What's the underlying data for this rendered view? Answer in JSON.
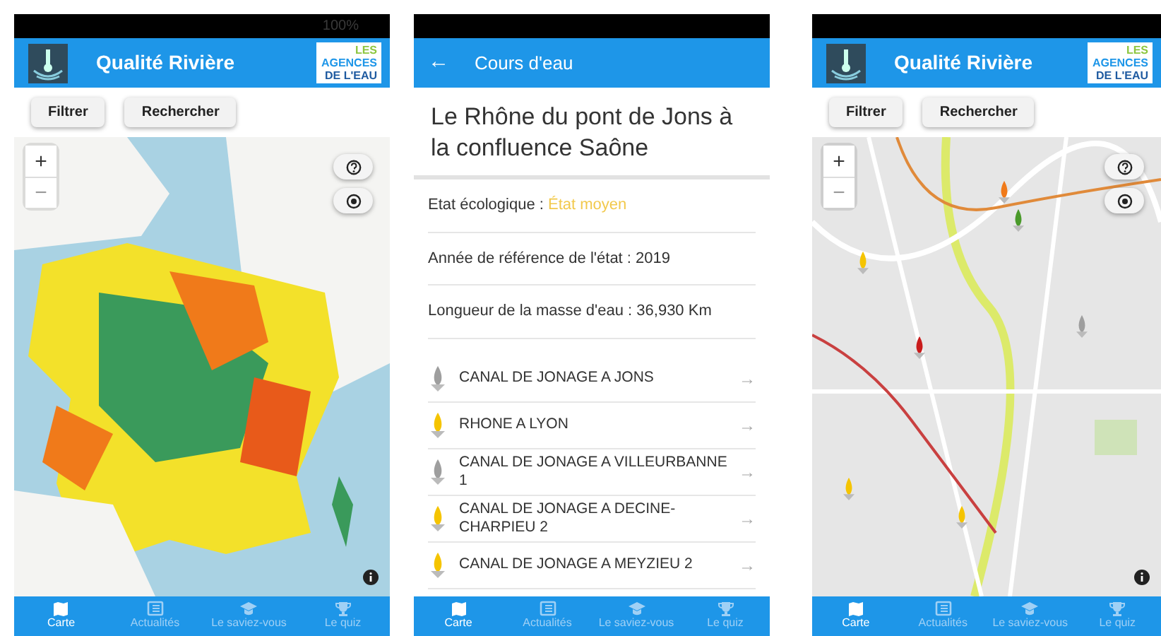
{
  "screens": [
    {
      "kind": "map",
      "status": "100%",
      "header": {
        "title": "Qualité Rivière",
        "partner_logo": [
          "LES",
          "AGENCES",
          "DE L'EAU"
        ]
      },
      "buttons": [
        "Filtrer",
        "Rechercher"
      ],
      "zoom": [
        "+",
        "−"
      ],
      "nav": [
        {
          "label": "Carte",
          "selected": true
        },
        {
          "label": "Actualités",
          "selected": false
        },
        {
          "label": "Le saviez-vous",
          "selected": false
        },
        {
          "label": "Le quiz",
          "selected": false
        }
      ]
    },
    {
      "kind": "detail",
      "header": {
        "title": "Cours d'eau",
        "back": "←"
      },
      "heading": "Le Rhône du pont de Jons à la confluence Saône",
      "facts": [
        {
          "label": "Etat écologique :",
          "value": "État moyen",
          "color": "#f2c94c"
        },
        {
          "label": "Année de référence de l'état :",
          "value": "2019"
        },
        {
          "label": "Longueur de la masse d'eau :",
          "value": "36,930 Km"
        }
      ],
      "stations": [
        {
          "name": "CANAL DE JONAGE A JONS",
          "color": "#9e9e9e",
          "arrow": "→"
        },
        {
          "name": "RHONE A LYON",
          "color": "#f5c400",
          "arrow": "→"
        },
        {
          "name": "CANAL DE JONAGE A VILLEURBANNE 1",
          "color": "#9e9e9e",
          "arrow": "→"
        },
        {
          "name": "CANAL DE JONAGE A DECINE-CHARPIEU 2",
          "color": "#f5c400",
          "arrow": "→"
        },
        {
          "name": "CANAL DE JONAGE A MEYZIEU 2",
          "color": "#f5c400",
          "arrow": "→"
        }
      ],
      "nav": [
        {
          "label": "Carte",
          "selected": true
        },
        {
          "label": "Actualités",
          "selected": false
        },
        {
          "label": "Le saviez-vous",
          "selected": false
        },
        {
          "label": "Le quiz",
          "selected": false
        }
      ]
    },
    {
      "kind": "map",
      "header": {
        "title": "Qualité Rivière",
        "partner_logo": [
          "LES",
          "AGENCES",
          "DE L'EAU"
        ]
      },
      "buttons": [
        "Filtrer",
        "Rechercher"
      ],
      "zoom": [
        "+",
        "−"
      ],
      "nav": [
        {
          "label": "Carte",
          "selected": true
        },
        {
          "label": "Actualités",
          "selected": false
        },
        {
          "label": "Le saviez-vous",
          "selected": false
        },
        {
          "label": "Le quiz",
          "selected": false
        }
      ]
    }
  ]
}
